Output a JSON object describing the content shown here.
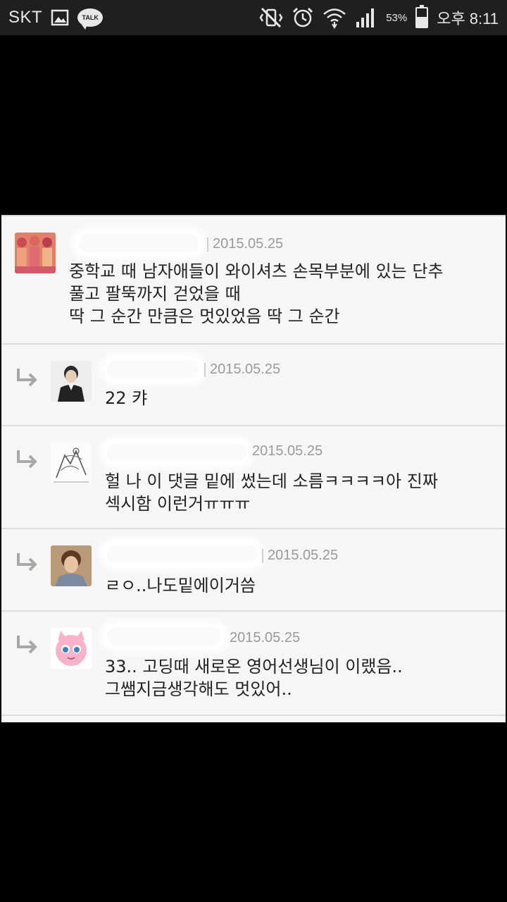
{
  "status_bar": {
    "carrier": "SKT",
    "left_icons": [
      "image-icon",
      "kakaotalk-icon"
    ],
    "talk_label": "TALK",
    "right_icons": [
      "vibrate-off-icon",
      "alarm-icon",
      "wifi-icon",
      "signal-icon",
      "battery-icon"
    ],
    "battery_percent": "53%",
    "battery_level": 0.53,
    "time": "오후 8:11"
  },
  "comments": [
    {
      "is_reply": false,
      "date": "2015.05.25",
      "text": "중학교 때 남자애들이 와이셔츠 손목부분에 있는 단추\n풀고 팔뚝까지 걷었을 때\n딱 그 순간 만큼은 멋있었음 딱 그 순간"
    },
    {
      "is_reply": true,
      "date": "2015.05.25",
      "text": "22 캬"
    },
    {
      "is_reply": true,
      "date": "2015.05.25",
      "text": "헐 나 이 댓글 밑에 썼는데 소름ㅋㅋㅋㅋ아 진짜\n섹시함 이런거ㅠㅠㅠ"
    },
    {
      "is_reply": true,
      "date": "2015.05.25",
      "text": "ㄹㅇ..나도밑에이거씀"
    },
    {
      "is_reply": true,
      "date": "2015.05.25",
      "text": "33.. 고딩때 새로온 영어선생님이 이랬음..\n그쌤지금생각해도 멋있어.."
    }
  ],
  "colors": {
    "status_bar_bg": "#1f1f1f",
    "panel_bg": "#f6f6f6",
    "date_text": "#9a9a9a",
    "body_text": "#222222",
    "divider": "#dedede"
  }
}
